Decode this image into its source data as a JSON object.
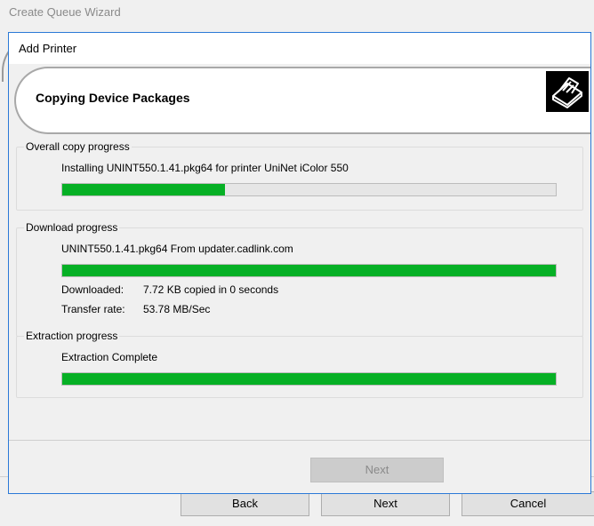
{
  "background": {
    "title": "Create Queue Wizard",
    "buttons": {
      "back": "Back",
      "next": "Next",
      "cancel": "Cancel"
    }
  },
  "dialog": {
    "title": "Add Printer",
    "heading": "Copying Device Packages",
    "icon": "printer-icon",
    "overall": {
      "label": "Overall copy progress",
      "status": "Installing UNINT550.1.41.pkg64 for printer UniNet iColor 550",
      "progress": 0.33
    },
    "download": {
      "label": "Download progress",
      "status": "UNINT550.1.41.pkg64 From updater.cadlink.com",
      "progress": 1.0,
      "downloaded_label": "Downloaded:",
      "downloaded_value": "7.72 KB copied in 0 seconds",
      "rate_label": "Transfer rate:",
      "rate_value": "53.78 MB/Sec"
    },
    "extraction": {
      "label": "Extraction progress",
      "status": "Extraction Complete",
      "progress": 1.0
    },
    "next_button": "Next"
  },
  "colors": {
    "progress": "#06b025",
    "dialog_border": "#2b79d7"
  }
}
